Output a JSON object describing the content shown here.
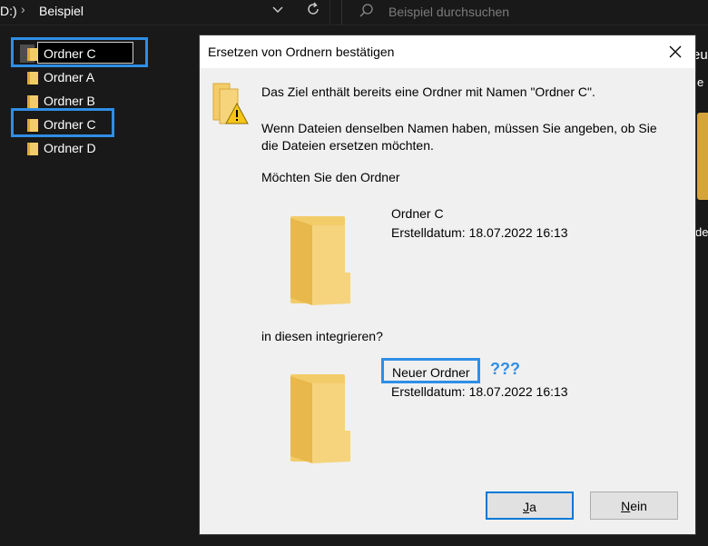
{
  "explorer": {
    "breadcrumb": {
      "drive": "D:)",
      "folder": "Beispiel"
    },
    "search": {
      "placeholder": "Beispiel durchsuchen"
    },
    "tree": [
      {
        "label": "Ordner C",
        "state": "renaming"
      },
      {
        "label": "Ordner A"
      },
      {
        "label": "Ordner B"
      },
      {
        "label": "Ordner C"
      },
      {
        "label": "Ordner D"
      }
    ],
    "right_fragments": {
      "t1": "eu",
      "t2": "e",
      "t3": "de"
    }
  },
  "dialog": {
    "title": "Ersetzen von Ordnern bestätigen",
    "line1": "Das Ziel enthält bereits eine Ordner mit Namen \"Ordner C\".",
    "line2a": "Wenn Dateien denselben Namen haben, müssen Sie angeben, ob Sie",
    "line2b": "die Dateien ersetzen möchten.",
    "question1": "Möchten Sie den Ordner",
    "source": {
      "name": "Ordner C",
      "created": "Erstelldatum: 18.07.2022 16:13"
    },
    "question2": "in diesen integrieren?",
    "target": {
      "name": "Neuer Ordner",
      "created": "Erstelldatum: 18.07.2022 16:13"
    },
    "annotation": "???",
    "buttons": {
      "yes_rest": "a",
      "yes_key": "J",
      "no_key": "N",
      "no_rest": "ein"
    }
  },
  "colors": {
    "highlight": "#2f8ee6",
    "folder": "#f3cc6a",
    "background": "#191919"
  }
}
